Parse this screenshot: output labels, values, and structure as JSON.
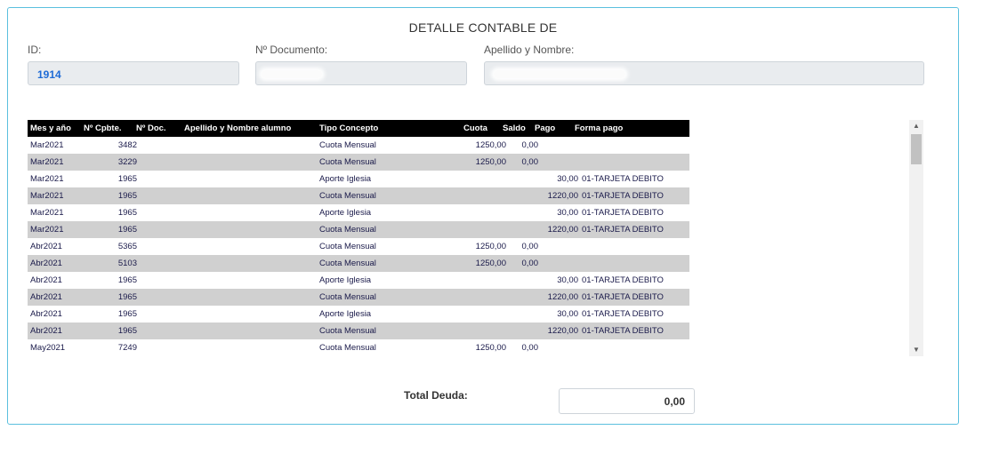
{
  "title": "DETALLE CONTABLE DE",
  "fields": {
    "id": {
      "label": "ID:",
      "value": "1914"
    },
    "documento": {
      "label": "Nº Documento:",
      "value": ""
    },
    "nombre": {
      "label": "Apellido y Nombre:",
      "value": ""
    }
  },
  "grid": {
    "columns": [
      "Mes y año",
      "Nº Cpbte.",
      "Nº Doc.",
      "Apellido y Nombre alumno",
      "Tipo Concepto",
      "Cuota",
      "Saldo",
      "Pago",
      "Forma pago"
    ],
    "rows": [
      [
        "Mar2021",
        "3482",
        "",
        "",
        "Cuota Mensual",
        "1250,00",
        "0,00",
        "",
        ""
      ],
      [
        "Mar2021",
        "3229",
        "",
        "",
        "Cuota Mensual",
        "1250,00",
        "0,00",
        "",
        ""
      ],
      [
        "Mar2021",
        "1965",
        "",
        "",
        "Aporte Iglesia",
        "",
        "",
        "30,00",
        "01-TARJETA DEBITO"
      ],
      [
        "Mar2021",
        "1965",
        "",
        "",
        "Cuota Mensual",
        "",
        "",
        "1220,00",
        "01-TARJETA DEBITO"
      ],
      [
        "Mar2021",
        "1965",
        "",
        "",
        "Aporte Iglesia",
        "",
        "",
        "30,00",
        "01-TARJETA DEBITO"
      ],
      [
        "Mar2021",
        "1965",
        "",
        "",
        "Cuota Mensual",
        "",
        "",
        "1220,00",
        "01-TARJETA DEBITO"
      ],
      [
        "Abr2021",
        "5365",
        "",
        "",
        "Cuota Mensual",
        "1250,00",
        "0,00",
        "",
        ""
      ],
      [
        "Abr2021",
        "5103",
        "",
        "",
        "Cuota Mensual",
        "1250,00",
        "0,00",
        "",
        ""
      ],
      [
        "Abr2021",
        "1965",
        "",
        "",
        "Aporte Iglesia",
        "",
        "",
        "30,00",
        "01-TARJETA DEBITO"
      ],
      [
        "Abr2021",
        "1965",
        "",
        "",
        "Cuota Mensual",
        "",
        "",
        "1220,00",
        "01-TARJETA DEBITO"
      ],
      [
        "Abr2021",
        "1965",
        "",
        "",
        "Aporte Iglesia",
        "",
        "",
        "30,00",
        "01-TARJETA DEBITO"
      ],
      [
        "Abr2021",
        "1965",
        "",
        "",
        "Cuota Mensual",
        "",
        "",
        "1220,00",
        "01-TARJETA DEBITO"
      ],
      [
        "May2021",
        "7249",
        "",
        "",
        "Cuota Mensual",
        "1250,00",
        "0,00",
        "",
        ""
      ]
    ]
  },
  "scroll": {
    "up_icon": "▲",
    "down_icon": "▼"
  },
  "total": {
    "label": "Total Deuda:",
    "value": "0,00"
  }
}
